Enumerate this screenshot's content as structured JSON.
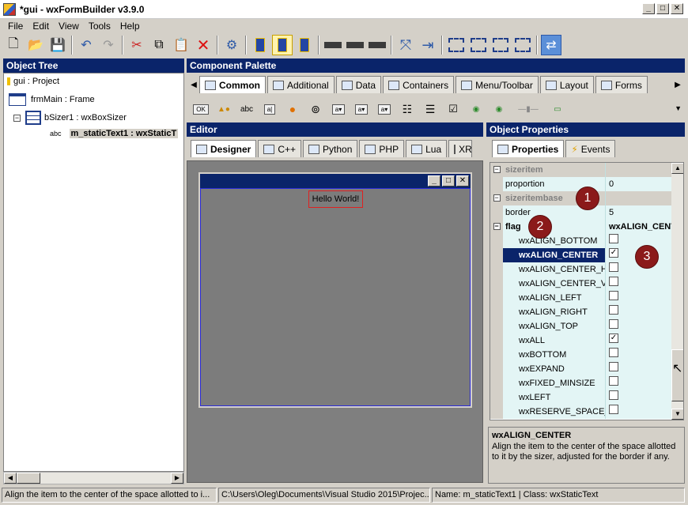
{
  "window": {
    "title": "*gui - wxFormBuilder v3.9.0",
    "minimize": "_",
    "maximize": "□",
    "close": "✕"
  },
  "menu": [
    "File",
    "Edit",
    "View",
    "Tools",
    "Help"
  ],
  "panels": {
    "object_tree": "Object Tree",
    "component_palette": "Component Palette",
    "editor": "Editor",
    "object_properties": "Object Properties"
  },
  "tree": {
    "project": "gui : Project",
    "frame": "frmMain : Frame",
    "sizer": "bSizer1 : wxBoxSizer",
    "text_icon": "abc",
    "selected": "m_staticText1 : wxStaticT"
  },
  "palette_tabs": [
    "Common",
    "Additional",
    "Data",
    "Containers",
    "Menu/Toolbar",
    "Layout",
    "Forms"
  ],
  "palette_items": {
    "ok": "OK",
    "abc": "abc"
  },
  "editor_tabs": [
    "Designer",
    "C++",
    "Python",
    "PHP",
    "Lua",
    "XR"
  ],
  "designer": {
    "label": "Hello World!"
  },
  "property_tabs": [
    "Properties",
    "Events"
  ],
  "properties": {
    "sizeritem": "sizeritem",
    "proportion": {
      "name": "proportion",
      "value": "0"
    },
    "sizeritembase": "sizeritembase",
    "border": {
      "name": "border",
      "value": "5"
    },
    "flag": {
      "name": "flag",
      "value": "wxALIGN_CENTER"
    },
    "flags": [
      {
        "name": "wxALIGN_BOTTOM",
        "checked": false
      },
      {
        "name": "wxALIGN_CENTER",
        "checked": true
      },
      {
        "name": "wxALIGN_CENTER_HO",
        "checked": false
      },
      {
        "name": "wxALIGN_CENTER_VE",
        "checked": false
      },
      {
        "name": "wxALIGN_LEFT",
        "checked": false
      },
      {
        "name": "wxALIGN_RIGHT",
        "checked": false
      },
      {
        "name": "wxALIGN_TOP",
        "checked": false
      },
      {
        "name": "wxALL",
        "checked": true
      },
      {
        "name": "wxBOTTOM",
        "checked": false
      },
      {
        "name": "wxEXPAND",
        "checked": false
      },
      {
        "name": "wxFIXED_MINSIZE",
        "checked": false
      },
      {
        "name": "wxLEFT",
        "checked": false
      },
      {
        "name": "wxRESERVE_SPACE_E",
        "checked": false
      }
    ]
  },
  "markers": [
    "1",
    "2",
    "3"
  ],
  "description": {
    "title": "wxALIGN_CENTER",
    "text": "Align the item to the center of the space allotted to it by the sizer, adjusted for the border if any."
  },
  "status": {
    "hint": "Align the item to the center of the space allotted to i...",
    "path": "C:\\Users\\Oleg\\Documents\\Visual Studio 2015\\Projec...",
    "object": "Name: m_staticText1 | Class: wxStaticText"
  },
  "colors": {
    "header": "#0a246a",
    "marker": "#8b1a1a",
    "selection": "#0a246a",
    "property_bg": "#e3f5f5"
  }
}
